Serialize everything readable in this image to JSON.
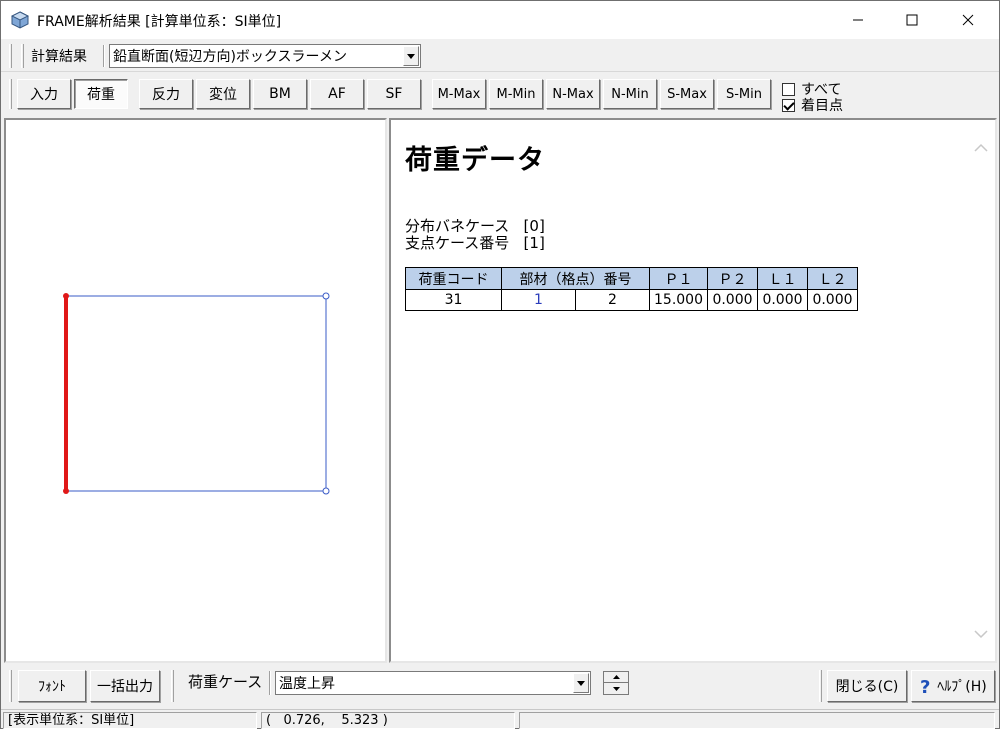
{
  "window": {
    "title": "FRAME解析結果  [計算単位系：SI単位]"
  },
  "toolbar1": {
    "calc_label": "計算結果",
    "section_value": "鉛直断面(短辺方向)ボックスラーメン"
  },
  "toolbar2": {
    "buttons": [
      "入力",
      "荷重",
      "反力",
      "変位",
      "BM",
      "AF",
      "SF",
      "M-Max",
      "M-Min",
      "N-Max",
      "N-Min",
      "S-Max",
      "S-Min"
    ],
    "active": "荷重",
    "check_all": {
      "label": "すべて",
      "checked": false
    },
    "check_focus": {
      "label": "着目点",
      "checked": true
    }
  },
  "right_pane": {
    "heading": "荷重データ",
    "spring_case": "分布バネケース   [0]",
    "support_case": "支点ケース番号   [1]",
    "table": {
      "headers": [
        "荷重コード",
        "部材（格点）番号",
        "Ｐ１",
        "Ｐ２",
        "Ｌ１",
        "Ｌ２"
      ],
      "rows": [
        {
          "code": "31",
          "member_from": "1",
          "member_to": "2",
          "p1": "15.000",
          "p2": "0.000",
          "l1": "0.000",
          "l2": "0.000"
        }
      ]
    }
  },
  "bottom": {
    "font_button": "ﾌｫﾝﾄ",
    "batch_button": "一括出力",
    "case_label": "荷重ケース",
    "case_value": "温度上昇",
    "close_button": "閉じる(C)",
    "help_button": "ﾍﾙﾌﾟ(H)"
  },
  "status": {
    "units": "[表示単位系：SI単位]",
    "coords": "(   0.726,    5.323 )"
  },
  "colors": {
    "loaded_member": "#e01818",
    "frame_line": "#3a5bc7",
    "table_header": "#bcd0ea"
  }
}
